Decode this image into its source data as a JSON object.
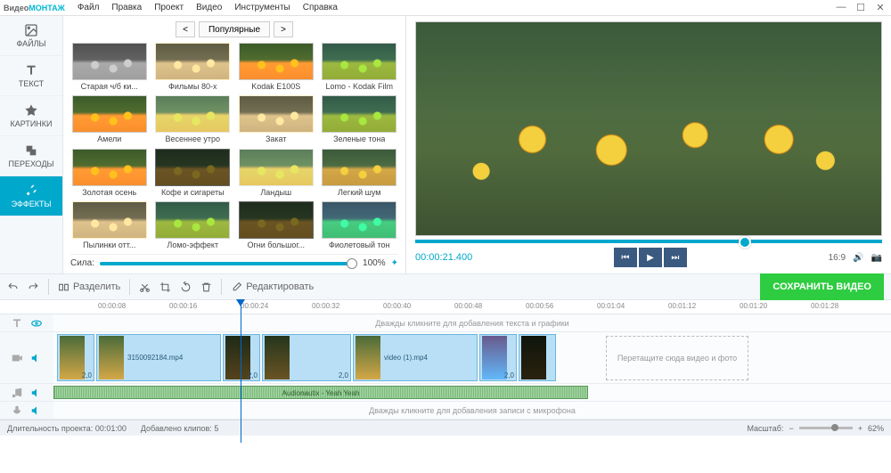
{
  "app": {
    "name1": "Видео",
    "name2": "МОНТАЖ"
  },
  "menu": [
    "Файл",
    "Правка",
    "Проект",
    "Видео",
    "Инструменты",
    "Справка"
  ],
  "sidebar": [
    {
      "label": "ФАЙЛЫ"
    },
    {
      "label": "ТЕКСТ"
    },
    {
      "label": "КАРТИНКИ"
    },
    {
      "label": "ПЕРЕХОДЫ"
    },
    {
      "label": "ЭФФЕКТЫ"
    }
  ],
  "category": "Популярные",
  "effects": [
    {
      "label": "Старая ч/б ки..."
    },
    {
      "label": "Фильмы 80-х"
    },
    {
      "label": "Kodak E100S"
    },
    {
      "label": "Lomo - Kodak Film"
    },
    {
      "label": "Амели"
    },
    {
      "label": "Весеннее утро"
    },
    {
      "label": "Закат"
    },
    {
      "label": "Зеленые тона"
    },
    {
      "label": "Золотая осень"
    },
    {
      "label": "Кофе и сигареты"
    },
    {
      "label": "Ландыш"
    },
    {
      "label": "Легкий шум"
    },
    {
      "label": "Пылинки отт..."
    },
    {
      "label": "Ломо-эффект"
    },
    {
      "label": "Огни большог..."
    },
    {
      "label": "Фиолетовый тон"
    }
  ],
  "strength": {
    "label": "Сила:",
    "value": "100%"
  },
  "preview": {
    "timecode": "00:00:21.400",
    "aspect": "16:9"
  },
  "toolbar": {
    "split": "Разделить",
    "edit": "Редактировать",
    "save": "СОХРАНИТЬ ВИДЕО"
  },
  "ruler": [
    "00:00:08",
    "00:00:16",
    "00:00:24",
    "00:00:32",
    "00:00:40",
    "00:00:48",
    "00:00:56",
    "00:01:04",
    "00:01:12",
    "00:01:20",
    "00:01:28"
  ],
  "tracks": {
    "text_hint": "Дважды кликните для добавления текста и графики",
    "mic_hint": "Дважды кликните для добавления записи с микрофона",
    "dropzone": "Перетащите сюда видео и фото",
    "video_clips": [
      {
        "name": "",
        "dur": "2,0"
      },
      {
        "name": "3150092184.mp4",
        "dur": ""
      },
      {
        "name": "",
        "dur": "2,0"
      },
      {
        "name": "",
        "dur": "2,0"
      },
      {
        "name": "video (1).mp4",
        "dur": ""
      },
      {
        "name": "",
        "dur": "2,0"
      },
      {
        "name": "",
        "dur": ""
      }
    ],
    "audio_name": "Audionautix - Yeah Yeah"
  },
  "status": {
    "duration_label": "Длительность проекта:",
    "duration": "00:01:00",
    "clips_label": "Добавлено клипов:",
    "clips": "5",
    "zoom_label": "Масштаб:",
    "zoom": "62%"
  }
}
